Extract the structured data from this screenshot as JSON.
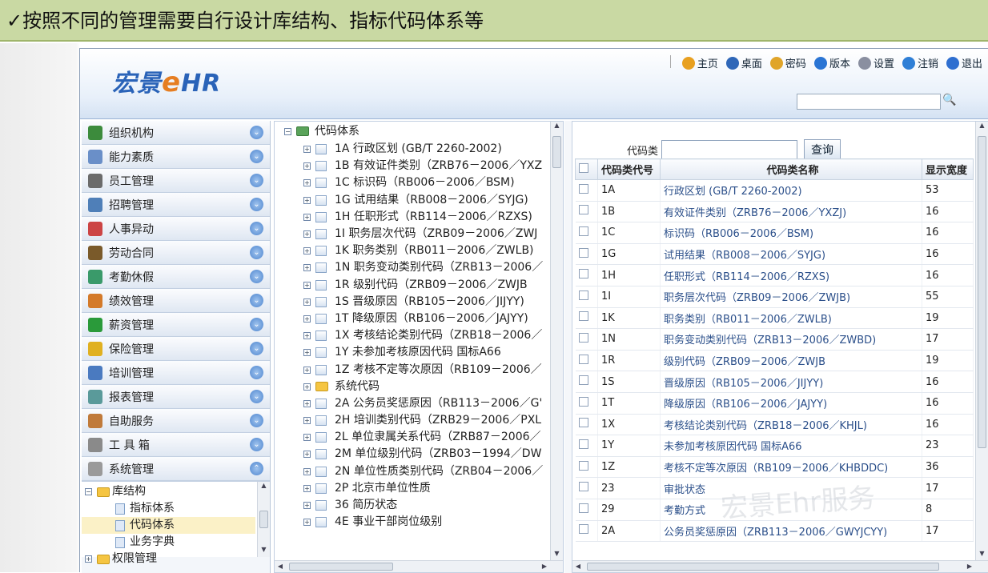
{
  "slide_title": "✓按照不同的管理需要自行设计库结构、指标代码体系等",
  "header": {
    "logo_text": "宏景",
    "logo_e": "e",
    "logo_hr": "HR",
    "nav": [
      {
        "icon": "home-icon",
        "label": "主页",
        "color": "#e8a020"
      },
      {
        "icon": "desktop-icon",
        "label": "桌面",
        "color": "#2f67b8"
      },
      {
        "icon": "lock-icon",
        "label": "密码",
        "color": "#e0a52a"
      },
      {
        "icon": "info-icon",
        "label": "版本",
        "color": "#2a75d4"
      },
      {
        "icon": "settings-icon",
        "label": "设置",
        "color": "#8a8fa0"
      },
      {
        "icon": "logout-icon",
        "label": "注销",
        "color": "#2f7fd6"
      },
      {
        "icon": "exit-icon",
        "label": "退出",
        "color": "#2f6fd0"
      }
    ]
  },
  "sidebar": {
    "items": [
      {
        "label": "组织机构",
        "icon": "org-icon",
        "color": "#3c8b3c"
      },
      {
        "label": "能力素质",
        "icon": "ability-icon",
        "color": "#6a8fc8"
      },
      {
        "label": "员工管理",
        "icon": "staff-icon",
        "color": "#6b6b6b"
      },
      {
        "label": "招聘管理",
        "icon": "recruit-icon",
        "color": "#4f7fb8"
      },
      {
        "label": "人事异动",
        "icon": "transfer-icon",
        "color": "#c44"
      },
      {
        "label": "劳动合同",
        "icon": "contract-icon",
        "color": "#7a5a2a"
      },
      {
        "label": "考勤休假",
        "icon": "attendance-icon",
        "color": "#3a9a6a"
      },
      {
        "label": "绩效管理",
        "icon": "performance-icon",
        "color": "#d47a2a"
      },
      {
        "label": "薪资管理",
        "icon": "salary-icon",
        "color": "#2a9a3a"
      },
      {
        "label": "保险管理",
        "icon": "insurance-icon",
        "color": "#e0b020"
      },
      {
        "label": "培训管理",
        "icon": "training-icon",
        "color": "#4a7ac0"
      },
      {
        "label": "报表管理",
        "icon": "report-icon",
        "color": "#5a9a9a"
      },
      {
        "label": "自助服务",
        "icon": "selfservice-icon",
        "color": "#c07a3a"
      },
      {
        "label": "工 具 箱",
        "icon": "toolbox-icon",
        "color": "#8a8a8a"
      },
      {
        "label": "系统管理",
        "icon": "system-icon",
        "color": "#9a9a9a"
      }
    ],
    "subtree": {
      "folder": "库结构",
      "children": [
        "指标体系",
        "代码体系",
        "业务字典"
      ],
      "folder2": "权限管理"
    }
  },
  "tree": {
    "root": "代码体系",
    "items": [
      "1A 行政区划 (GB/T 2260-2002)",
      "1B 有效证件类别（ZRB76－2006／YXZ",
      "1C 标识码（RB006－2006／BSM)",
      "1G 试用结果（RB008－2006／SYJG)",
      "1H 任职形式（RB114－2006／RZXS)",
      "1I 职务层次代码（ZRB09－2006／ZWJ",
      "1K 职务类别（RB011－2006／ZWLB)",
      "1N 职务变动类别代码（ZRB13－2006／",
      "1R 级别代码（ZRB09－2006／ZWJB",
      "1S 晋级原因（RB105－2006／JIJYY)",
      "1T 降级原因（RB106－2006／JAJYY)",
      "1X 考核结论类别代码（ZRB18－2006／",
      "1Y 未参加考核原因代码 国标A66",
      "1Z 考核不定等次原因（RB109－2006／",
      "系统代码",
      "2A 公务员奖惩原因（RB113－2006／G'",
      "2H 培训类别代码（ZRB29－2006／PXL",
      "2L 单位隶属关系代码（ZRB87－2006／",
      "2M 单位级别代码（ZRB03－1994／DW",
      "2N 单位性质类别代码（ZRB04－2006／",
      "2P 北京市单位性质",
      "36 简历状态",
      "4E 事业干部岗位级别"
    ]
  },
  "grid": {
    "search_label": "代码类",
    "search_value": "",
    "query_button": "查询",
    "columns": [
      "代码类代号",
      "代码类名称",
      "显示宽度"
    ],
    "rows": [
      [
        "1A",
        "行政区划 (GB/T 2260-2002)",
        "53"
      ],
      [
        "1B",
        "有效证件类别（ZRB76－2006／YXZJ)",
        "16"
      ],
      [
        "1C",
        "标识码（RB006－2006／BSM)",
        "16"
      ],
      [
        "1G",
        "试用结果（RB008－2006／SYJG)",
        "16"
      ],
      [
        "1H",
        "任职形式（RB114－2006／RZXS)",
        "16"
      ],
      [
        "1I",
        "职务层次代码（ZRB09－2006／ZWJB)",
        "55"
      ],
      [
        "1K",
        "职务类别（RB011－2006／ZWLB)",
        "19"
      ],
      [
        "1N",
        "职务变动类别代码（ZRB13－2006／ZWBD)",
        "17"
      ],
      [
        "1R",
        "级别代码（ZRB09－2006／ZWJB",
        "19"
      ],
      [
        "1S",
        "晋级原因（RB105－2006／JIJYY)",
        "16"
      ],
      [
        "1T",
        "降级原因（RB106－2006／JAJYY)",
        "16"
      ],
      [
        "1X",
        "考核结论类别代码（ZRB18－2006／KHJL)",
        "16"
      ],
      [
        "1Y",
        "未参加考核原因代码 国标A66",
        "23"
      ],
      [
        "1Z",
        "考核不定等次原因（RB109－2006／KHBDDC)",
        "36"
      ],
      [
        "23",
        "审批状态",
        "17"
      ],
      [
        "29",
        "考勤方式",
        "8"
      ],
      [
        "2A",
        "公务员奖惩原因（ZRB113－2006／GWYJCYY)",
        "17"
      ]
    ]
  },
  "watermark": "宏景Ehr服务"
}
